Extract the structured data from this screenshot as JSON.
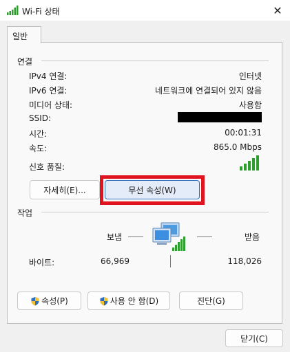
{
  "window": {
    "title": "Wi-Fi 상태",
    "close_glyph": "✕",
    "icon": "wifi-signal-icon"
  },
  "tab": {
    "label": "일반"
  },
  "connection": {
    "group_label": "연결",
    "rows": [
      {
        "label": "IPv4 연결:",
        "value": "인터넷"
      },
      {
        "label": "IPv6 연결:",
        "value": "네트워크에 연결되어 있지 않음"
      },
      {
        "label": "미디어 상태:",
        "value": "사용함"
      },
      {
        "label": "SSID:",
        "value": ""
      },
      {
        "label": "시간:",
        "value": "00:01:31"
      },
      {
        "label": "속도:",
        "value": "865.0 Mbps"
      }
    ],
    "signal_label": "신호 품질:",
    "signal_bars": 5,
    "details_button": "자세히(E)...",
    "wireless_properties_button": "무선 속성(W)"
  },
  "activity": {
    "group_label": "작업",
    "sent_label": "보냄",
    "received_label": "받음",
    "bytes_label": "바이트:",
    "bytes_sent": "66,969",
    "bytes_received": "118,026"
  },
  "actions": {
    "properties": "속성(P)",
    "disable": "사용 안 함(D)",
    "diagnose": "진단(G)"
  },
  "footer": {
    "close_button": "닫기(C)"
  },
  "colors": {
    "highlight": "#e0141e",
    "signal": "#2e9e2e"
  }
}
